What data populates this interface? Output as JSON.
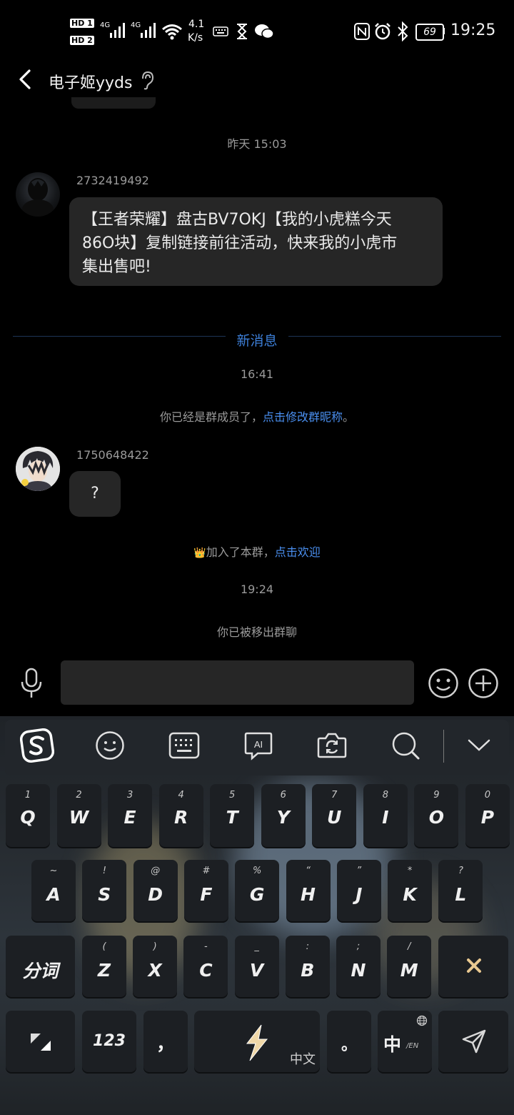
{
  "status_bar": {
    "hd1": "HD 1",
    "hd2": "HD 2",
    "sig1": "4G",
    "sig2": "4G",
    "speed_value": "4.1",
    "speed_unit": "K/s",
    "battery": "69",
    "time": "19:25"
  },
  "header": {
    "title": "电子姬yyds"
  },
  "chat": {
    "time1": "昨天 15:03",
    "msg1": {
      "nick": "2732419492",
      "lines": [
        "【王者荣耀】盘古BV7OKJ【我的小虎糕今天",
        "86O块】复制链接前往活动，快来我的小虎市",
        "集出售吧!"
      ]
    },
    "new_msg_divider": "新消息",
    "time2": "16:41",
    "sys1_prefix": "你已经是群成员了，",
    "sys1_link": "点击修改群昵称",
    "sys1_suffix": "。",
    "msg2": {
      "nick": "1750648422",
      "text": "?"
    },
    "sys2_icon": "👑",
    "sys2_text": "加入了本群，",
    "sys2_link": "点击欢迎",
    "time3": "19:24",
    "sys3": "你已被移出群聊"
  },
  "input_bar": {
    "placeholder": ""
  },
  "keyboard": {
    "toolbar_icons": [
      "sogou-logo-icon",
      "emoji-icon",
      "keyboard-icon",
      "ai-icon",
      "camera-icon",
      "search-icon",
      "collapse-icon"
    ],
    "row1": [
      {
        "sub": "1",
        "main": "Q"
      },
      {
        "sub": "2",
        "main": "W"
      },
      {
        "sub": "3",
        "main": "E"
      },
      {
        "sub": "4",
        "main": "R"
      },
      {
        "sub": "5",
        "main": "T"
      },
      {
        "sub": "6",
        "main": "Y"
      },
      {
        "sub": "7",
        "main": "U"
      },
      {
        "sub": "8",
        "main": "I"
      },
      {
        "sub": "9",
        "main": "O"
      },
      {
        "sub": "0",
        "main": "P"
      }
    ],
    "row2": [
      {
        "sub": "~",
        "main": "A"
      },
      {
        "sub": "!",
        "main": "S"
      },
      {
        "sub": "@",
        "main": "D"
      },
      {
        "sub": "#",
        "main": "F"
      },
      {
        "sub": "%",
        "main": "G"
      },
      {
        "sub": "“",
        "main": "H"
      },
      {
        "sub": "”",
        "main": "J"
      },
      {
        "sub": "*",
        "main": "K"
      },
      {
        "sub": "?",
        "main": "L"
      }
    ],
    "row3": [
      {
        "sub": "(",
        "main": "Z"
      },
      {
        "sub": ")",
        "main": "X"
      },
      {
        "sub": "-",
        "main": "C"
      },
      {
        "sub": "_",
        "main": "V"
      },
      {
        "sub": ":",
        "main": "B"
      },
      {
        "sub": ";",
        "main": "N"
      },
      {
        "sub": "/",
        "main": "M"
      }
    ],
    "fenci": "分词",
    "num_key": "123",
    "comma": "，",
    "space_label": "中文",
    "period": "。",
    "lang_key": "中",
    "lang_sub": "/EN"
  }
}
